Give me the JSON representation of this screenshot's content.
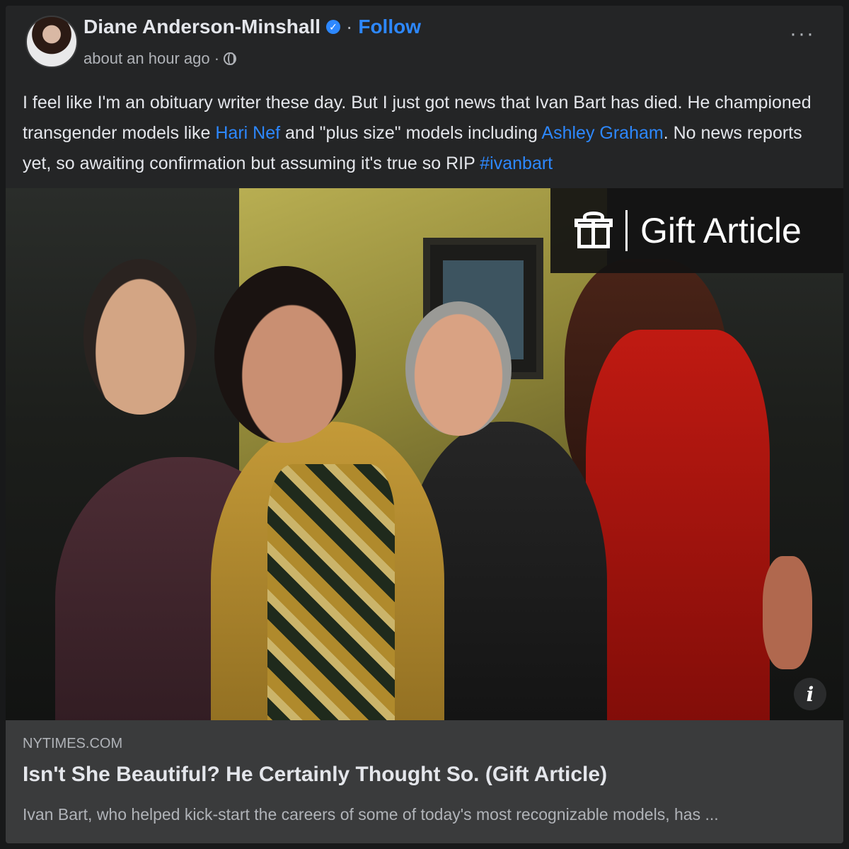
{
  "header": {
    "author_name": "Diane Anderson-Minshall",
    "verified_glyph": "✓",
    "separator": "·",
    "follow_label": "Follow",
    "timestamp": "about an hour ago ·",
    "more_label": "···",
    "icons": [
      "avatar",
      "verified-badge-icon",
      "globe-icon",
      "more-options-icon"
    ]
  },
  "post": {
    "text_1": "I feel like I'm an obituary writer these day. But I just got news that Ivan Bart has died. He championed transgender models like ",
    "link_1": "Hari Nef",
    "text_2": " and \"plus size\" models including ",
    "link_2": "Ashley Graham",
    "text_3": ". No news reports yet, so awaiting confirmation but assuming it's true so RIP ",
    "hashtag": "#ivanbart"
  },
  "image": {
    "badge_label": "Gift Article",
    "badge_icon": "gift-icon",
    "info_label": "i"
  },
  "link_preview": {
    "domain": "NYTIMES.COM",
    "title": "Isn't She Beautiful? He Certainly Thought So. (Gift Article)",
    "description": "Ivan Bart, who helped kick-start the careers of some of today's most recognizable models, has ..."
  },
  "colors": {
    "background": "#242526",
    "link": "#2d88ff",
    "text": "#e4e6eb",
    "muted": "#b0b3b8",
    "card": "#3a3b3c"
  }
}
